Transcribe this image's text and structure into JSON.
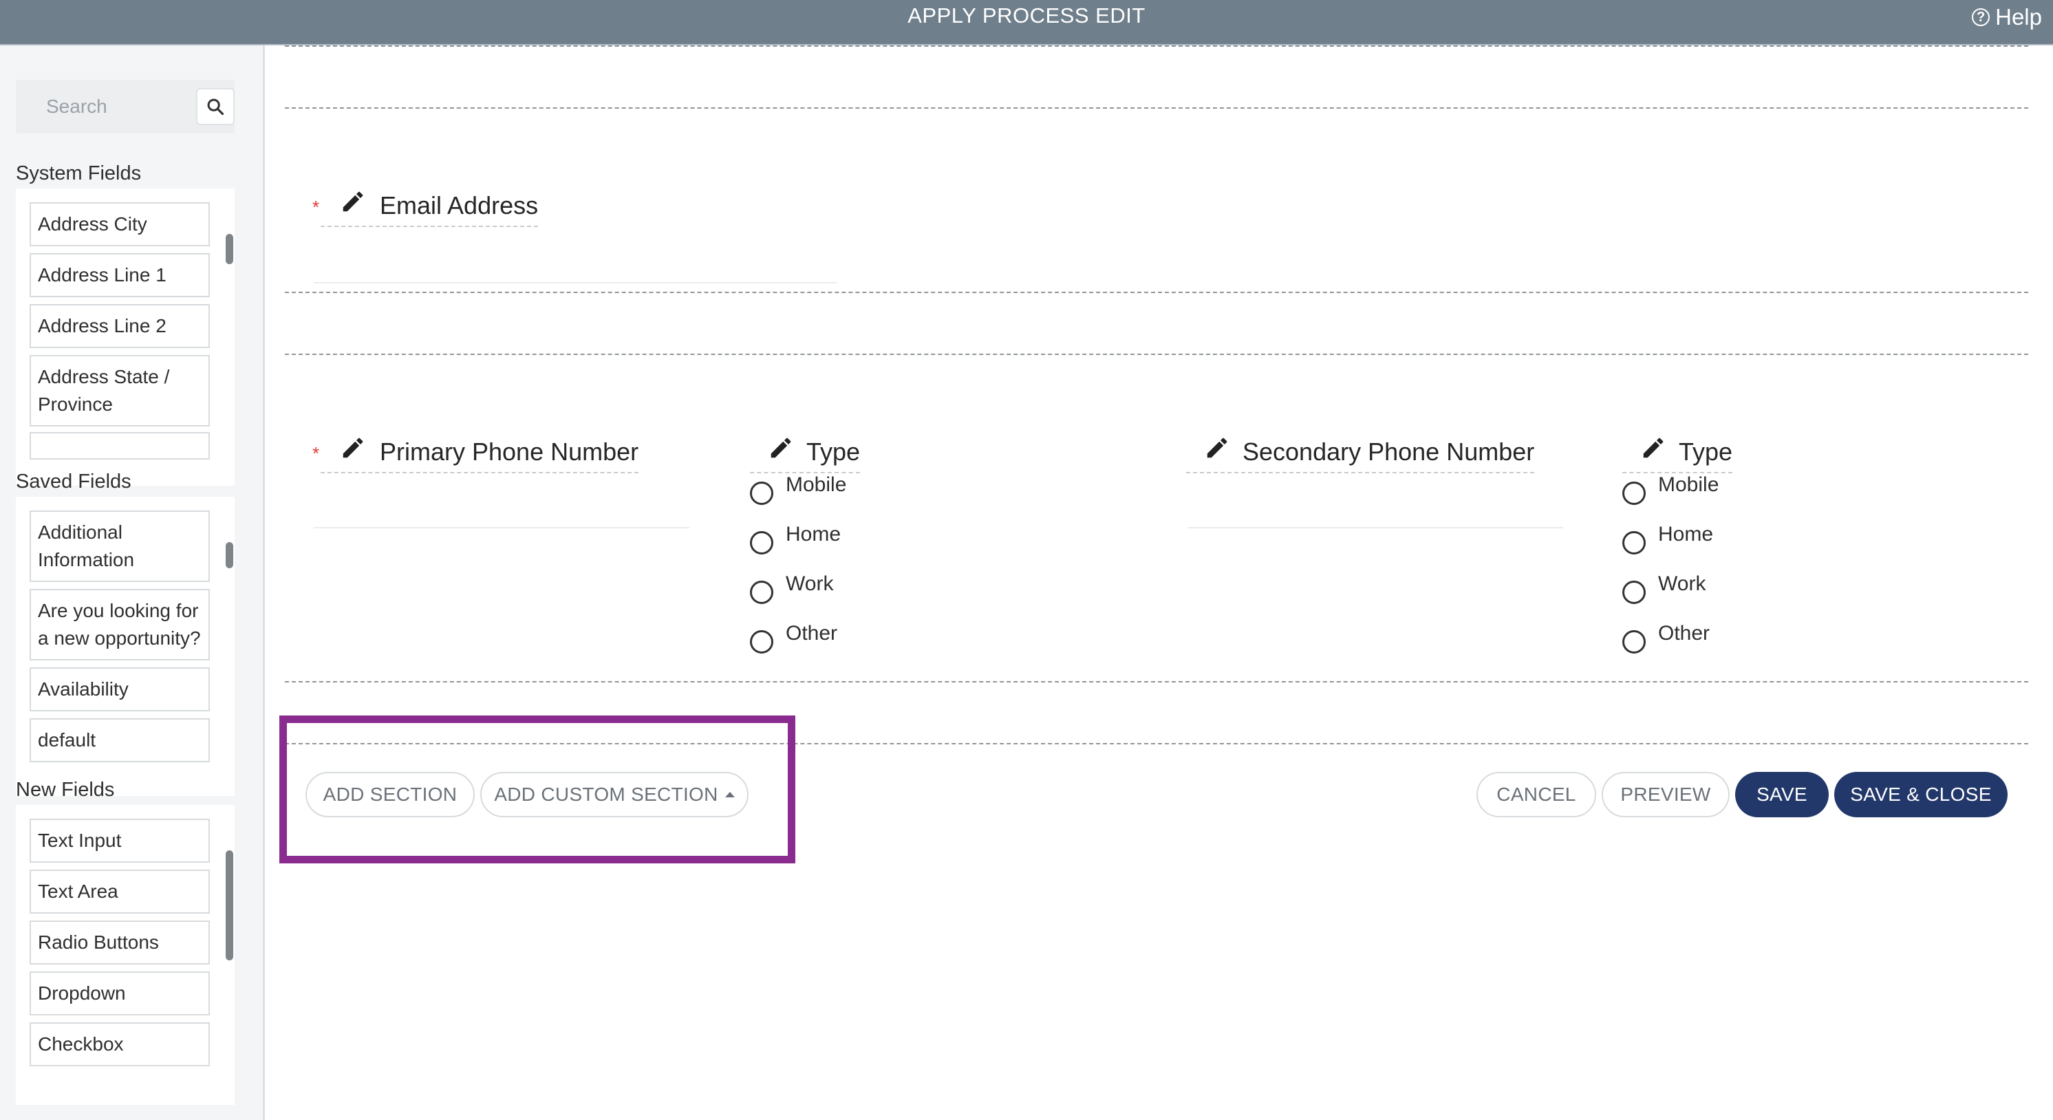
{
  "header": {
    "title": "APPLY PROCESS EDIT",
    "help_label": "Help",
    "background_color": "#6f7f8b"
  },
  "sidebar": {
    "search": {
      "placeholder": "Search",
      "icon": "search-icon"
    },
    "system_fields": {
      "title": "System Fields",
      "items": [
        "Address City",
        "Address Line 1",
        "Address Line 2",
        "Address State / Province"
      ]
    },
    "saved_fields": {
      "title": "Saved Fields",
      "items": [
        "Additional Information",
        "Are you looking for a new opportunity?",
        "Availability",
        "default"
      ]
    },
    "new_fields": {
      "title": "New Fields",
      "items": [
        "Text Input",
        "Text Area",
        "Radio Buttons",
        "Dropdown",
        "Checkbox"
      ]
    }
  },
  "form": {
    "required_marker": "*",
    "email_field": {
      "label": "Email Address",
      "required": true
    },
    "primary_phone": {
      "label": "Primary Phone Number",
      "required": true
    },
    "primary_type": {
      "label": "Type",
      "options": [
        "Mobile",
        "Home",
        "Work",
        "Other"
      ]
    },
    "secondary_phone": {
      "label": "Secondary Phone Number",
      "required": false
    },
    "secondary_type": {
      "label": "Type",
      "options": [
        "Mobile",
        "Home",
        "Work",
        "Other"
      ]
    }
  },
  "actions": {
    "add_section": "ADD SECTION",
    "add_custom_section": "ADD CUSTOM SECTION",
    "cancel": "CANCEL",
    "preview": "PREVIEW",
    "save": "SAVE",
    "save_close": "SAVE & CLOSE"
  },
  "colors": {
    "primary_button": "#22386b",
    "required": "#e53935",
    "highlight": "#8a2b8f"
  }
}
